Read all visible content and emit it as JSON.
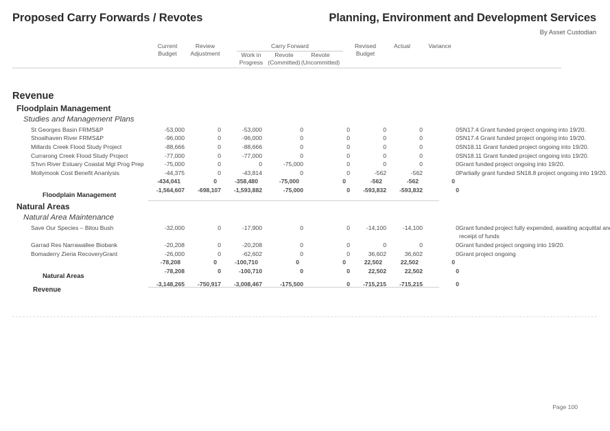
{
  "header": {
    "title": "Proposed Carry Forwards / Revotes",
    "department": "Planning, Environment and Development Services",
    "subtitle": "By Asset Custodian"
  },
  "columns": {
    "current_budget": [
      "Current",
      "Budget"
    ],
    "review_adjustment": [
      "Review",
      "Adjustment"
    ],
    "carry_forward_group": "Carry Forward",
    "work_in_progress": [
      "Work in",
      "Progress"
    ],
    "revote_committed": [
      "Revote",
      "(Committed)"
    ],
    "revote_uncommitted": [
      "Revote",
      "(Uncommitted)"
    ],
    "revised_budget": [
      "Revised",
      "Budget"
    ],
    "actual": "Actual",
    "variance": "Variance"
  },
  "sections": {
    "revenue_heading": "Revenue",
    "floodplain_heading": "Floodplain Management",
    "studies_heading": "Studies and Management Plans",
    "natural_areas_heading": "Natural Areas",
    "natural_area_maintenance_heading": "Natural Area Maintenance"
  },
  "rows": {
    "st_georges": {
      "label": "St Georges Basin FRMS&P",
      "current_budget": "-53,000",
      "review_adjustment": "0",
      "work_in_progress": "-53,000",
      "revote_committed": "0",
      "revote_uncommitted": "0",
      "revised_budget": "0",
      "actual": "0",
      "variance": "0",
      "note": "SN17.4 Grant funded project ongoing into 19/20."
    },
    "shoalhaven_river": {
      "label": "Shoalhaven River FRMS&P",
      "current_budget": "-96,000",
      "review_adjustment": "0",
      "work_in_progress": "-96,000",
      "revote_committed": "0",
      "revote_uncommitted": "0",
      "revised_budget": "0",
      "actual": "0",
      "variance": "0",
      "note": "SN17.4 Grant funded project ongoing into 19/20."
    },
    "millards_creek": {
      "label": "Millards Creek Flood Study Project",
      "current_budget": "-88,666",
      "review_adjustment": "0",
      "work_in_progress": "-88,666",
      "revote_committed": "0",
      "revote_uncommitted": "0",
      "revised_budget": "0",
      "actual": "0",
      "variance": "0",
      "note": "SN18.11 Grant funded project ongoing into 19/20."
    },
    "currarong_creek": {
      "label": "Currarong Creek Flood Study Project",
      "current_budget": "-77,000",
      "review_adjustment": "0",
      "work_in_progress": "-77,000",
      "revote_committed": "0",
      "revote_uncommitted": "0",
      "revised_budget": "0",
      "actual": "0",
      "variance": "0",
      "note": "SN18.11 Grant funded project ongoing into 19/20."
    },
    "shvn_river_estuary": {
      "label": "S'hvn River Estuary Coastal Mgt Prog Prep",
      "current_budget": "-75,000",
      "review_adjustment": "0",
      "work_in_progress": "0",
      "revote_committed": "-75,000",
      "revote_uncommitted": "0",
      "revised_budget": "0",
      "actual": "0",
      "variance": "0",
      "note": "Grant funded project ongoing into 19/20."
    },
    "mollymook": {
      "label": "Mollymook Cost Benefit Ananlysis",
      "current_budget": "-44,375",
      "review_adjustment": "0",
      "work_in_progress": "-43,814",
      "revote_committed": "0",
      "revote_uncommitted": "0",
      "revised_budget": "-562",
      "actual": "-562",
      "variance": "0",
      "note": "Partially grant funded SN18.8 project ongoing into 19/20."
    },
    "studies_subtotal": {
      "label": "",
      "current_budget": "-434,041",
      "review_adjustment": "0",
      "work_in_progress": "-358,480",
      "revote_committed": "-75,000",
      "revote_uncommitted": "0",
      "revised_budget": "-562",
      "actual": "-562",
      "variance": "0",
      "note": ""
    },
    "floodplain_total": {
      "label": "Floodplain Management",
      "current_budget": "-1,564,607",
      "review_adjustment": "-698,107",
      "work_in_progress": "-1,593,882",
      "revote_committed": "-75,000",
      "revote_uncommitted": "0",
      "revised_budget": "-593,832",
      "actual": "-593,832",
      "variance": "0",
      "note": ""
    },
    "save_our_species": {
      "label": "Save Our Species – Bitou Bush",
      "current_budget": "-32,000",
      "review_adjustment": "0",
      "work_in_progress": "-17,900",
      "revote_committed": "0",
      "revote_uncommitted": "0",
      "revised_budget": "-14,100",
      "actual": "-14,100",
      "variance": "0",
      "note": "Grant funded project fully expended, awaiting acquittal and receipt of funds"
    },
    "garrad_res": {
      "label": "Garrad Res Narrawallee Biobank",
      "current_budget": "-20,208",
      "review_adjustment": "0",
      "work_in_progress": "-20,208",
      "revote_committed": "0",
      "revote_uncommitted": "0",
      "revised_budget": "0",
      "actual": "0",
      "variance": "0",
      "note": "Grant funded project ongoing into 19/20."
    },
    "bomaderry_zieria": {
      "label": "Bomaderry Zieria RecoveryGrant",
      "current_budget": "-26,000",
      "review_adjustment": "0",
      "work_in_progress": "-62,602",
      "revote_committed": "0",
      "revote_uncommitted": "0",
      "revised_budget": "36,602",
      "actual": "36,602",
      "variance": "0",
      "note": "Grant project ongoing"
    },
    "nam_subtotal": {
      "label": "",
      "current_budget": "-78,208",
      "review_adjustment": "0",
      "work_in_progress": "-100,710",
      "revote_committed": "0",
      "revote_uncommitted": "0",
      "revised_budget": "22,502",
      "actual": "22,502",
      "variance": "0",
      "note": ""
    },
    "natural_areas_total": {
      "label": "Natural Areas",
      "current_budget": "-78,208",
      "review_adjustment": "0",
      "work_in_progress": "-100,710",
      "revote_committed": "0",
      "revote_uncommitted": "0",
      "revised_budget": "22,502",
      "actual": "22,502",
      "variance": "0",
      "note": ""
    },
    "revenue_total": {
      "label": "Revenue",
      "current_budget": "-3,148,265",
      "review_adjustment": "-750,917",
      "work_in_progress": "-3,008,467",
      "revote_committed": "-175,500",
      "revote_uncommitted": "0",
      "revised_budget": "-715,215",
      "actual": "-715,215",
      "variance": "0",
      "note": ""
    }
  },
  "footer": {
    "page": "Page 100"
  },
  "colors": {
    "text": "#3a3a3a",
    "heading": "#2b2b2b",
    "rule": "#cfcfcf",
    "rule_light": "#e6e6e6",
    "dash": "#dcdcdc"
  }
}
